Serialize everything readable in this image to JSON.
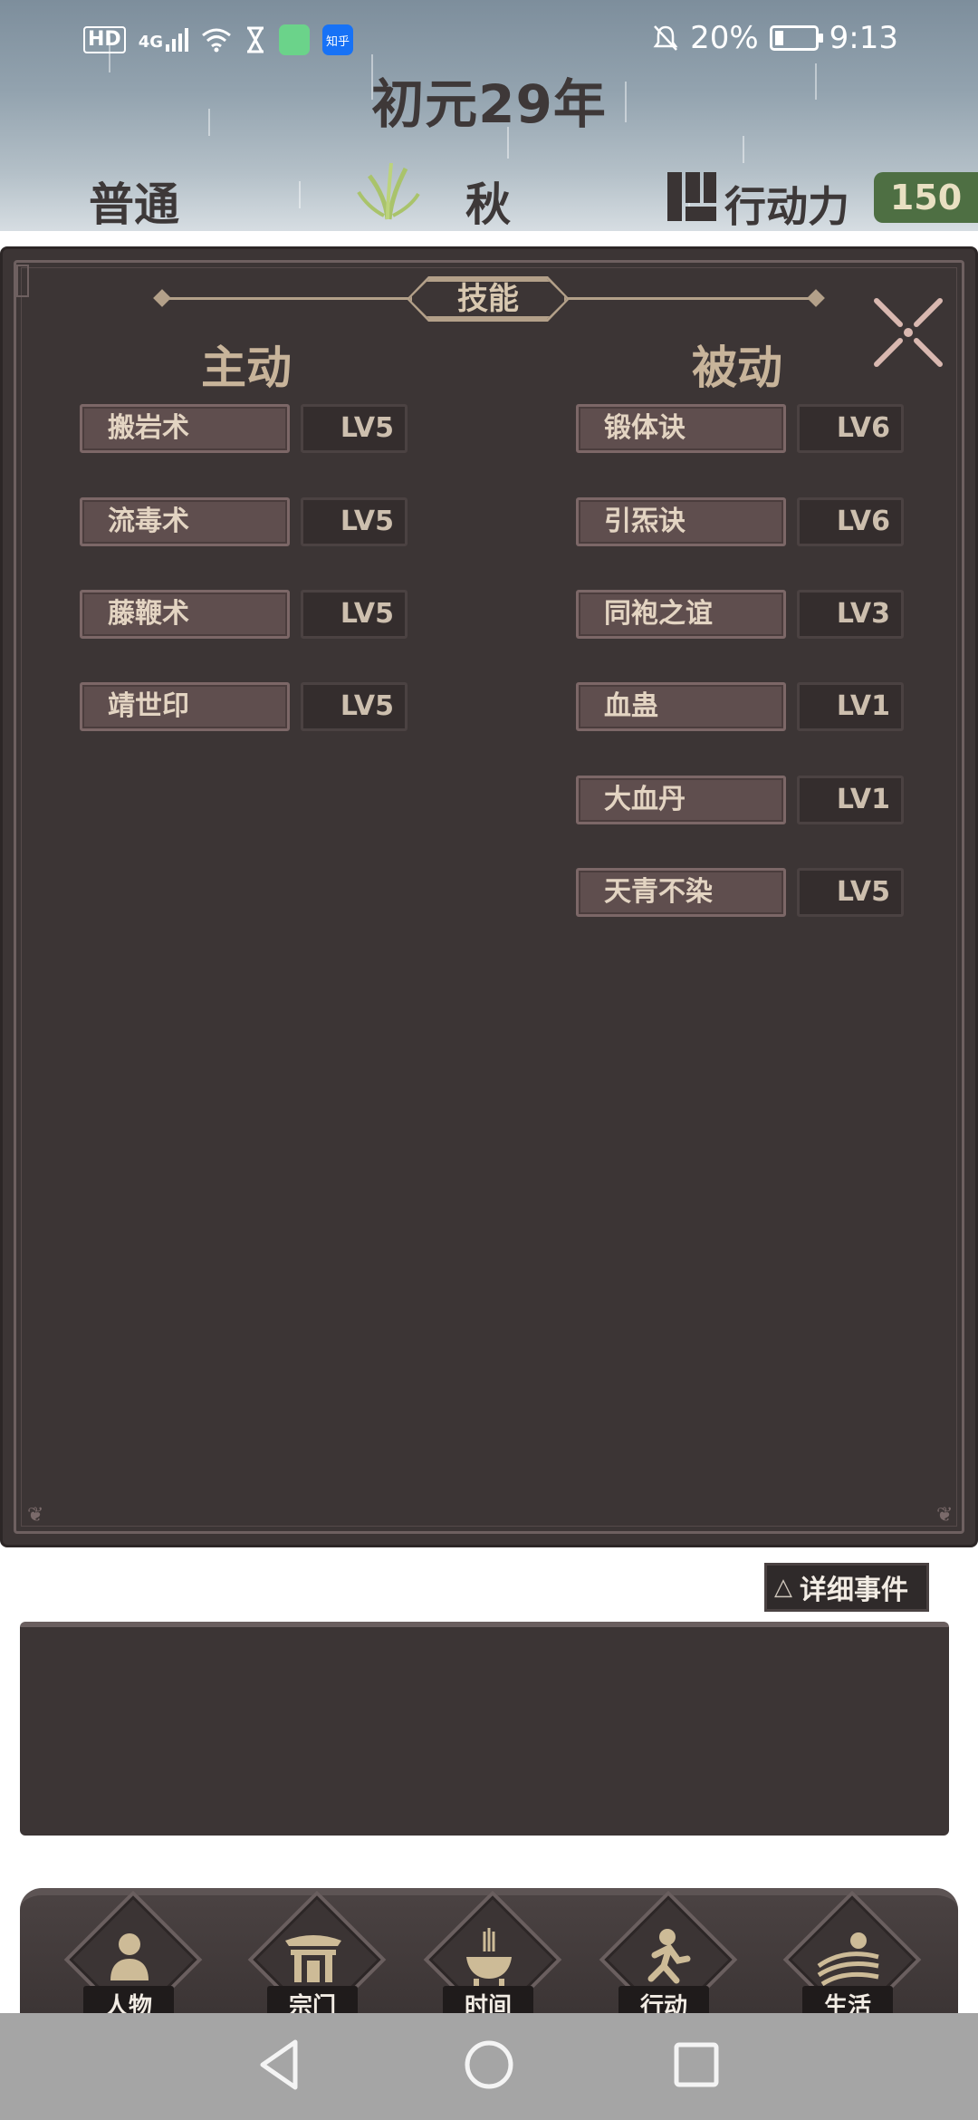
{
  "status_bar": {
    "left_icons": [
      "hd-icon",
      "4g-signal-icon",
      "wifi-icon",
      "hourglass-icon",
      "app-icon",
      "zhihu-app-icon"
    ],
    "hd_text": "HD",
    "network_text": "4G",
    "zhihu_text": "知乎",
    "battery_text": "20%",
    "time": "9:13"
  },
  "header": {
    "year": "初元29年",
    "difficulty": "普通",
    "season": "秋",
    "action_points_label": "行动力",
    "action_points_value": "150"
  },
  "skills_panel": {
    "title": "技能",
    "active_header": "主动",
    "passive_header": "被动",
    "active": [
      {
        "name": "搬岩术",
        "level": "LV5"
      },
      {
        "name": "流毒术",
        "level": "LV5"
      },
      {
        "name": "藤鞭术",
        "level": "LV5"
      },
      {
        "name": "靖世印",
        "level": "LV5"
      }
    ],
    "passive": [
      {
        "name": "锻体诀",
        "level": "LV6"
      },
      {
        "name": "引炁诀",
        "level": "LV6"
      },
      {
        "name": "同袍之谊",
        "level": "LV3"
      },
      {
        "name": "血蛊",
        "level": "LV1"
      },
      {
        "name": "大血丹",
        "level": "LV1"
      },
      {
        "name": "天青不染",
        "level": "LV5"
      }
    ]
  },
  "events": {
    "button_icon": "△",
    "button_label": "详细事件"
  },
  "bottom_nav": [
    {
      "label": "人物",
      "icon": "person-icon"
    },
    {
      "label": "宗门",
      "icon": "sect-gate-icon"
    },
    {
      "label": "时间",
      "icon": "incense-burner-icon"
    },
    {
      "label": "行动",
      "icon": "action-runner-icon"
    },
    {
      "label": "生活",
      "icon": "life-landscape-icon"
    }
  ],
  "colors": {
    "panel_bg": "#3c3535",
    "skill_name_bg": "#5f4e4e",
    "gold_text": "#c8b49a",
    "action_points_bg": "#4e6f43"
  }
}
